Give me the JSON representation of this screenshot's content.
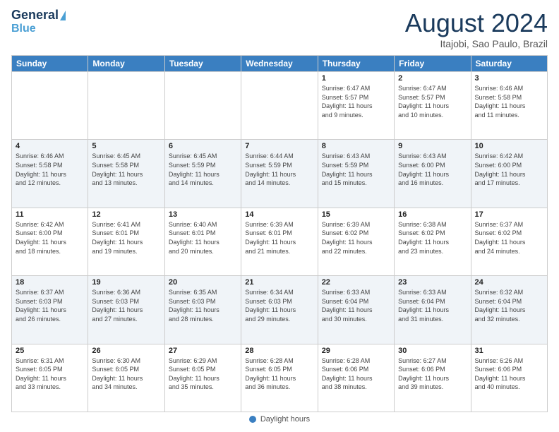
{
  "header": {
    "logo_line1": "General",
    "logo_line2": "Blue",
    "month_title": "August 2024",
    "subtitle": "Itajobi, Sao Paulo, Brazil"
  },
  "days_of_week": [
    "Sunday",
    "Monday",
    "Tuesday",
    "Wednesday",
    "Thursday",
    "Friday",
    "Saturday"
  ],
  "footer_label": "Daylight hours",
  "weeks": [
    [
      {
        "day": "",
        "info": ""
      },
      {
        "day": "",
        "info": ""
      },
      {
        "day": "",
        "info": ""
      },
      {
        "day": "",
        "info": ""
      },
      {
        "day": "1",
        "info": "Sunrise: 6:47 AM\nSunset: 5:57 PM\nDaylight: 11 hours\nand 9 minutes."
      },
      {
        "day": "2",
        "info": "Sunrise: 6:47 AM\nSunset: 5:57 PM\nDaylight: 11 hours\nand 10 minutes."
      },
      {
        "day": "3",
        "info": "Sunrise: 6:46 AM\nSunset: 5:58 PM\nDaylight: 11 hours\nand 11 minutes."
      }
    ],
    [
      {
        "day": "4",
        "info": "Sunrise: 6:46 AM\nSunset: 5:58 PM\nDaylight: 11 hours\nand 12 minutes."
      },
      {
        "day": "5",
        "info": "Sunrise: 6:45 AM\nSunset: 5:58 PM\nDaylight: 11 hours\nand 13 minutes."
      },
      {
        "day": "6",
        "info": "Sunrise: 6:45 AM\nSunset: 5:59 PM\nDaylight: 11 hours\nand 14 minutes."
      },
      {
        "day": "7",
        "info": "Sunrise: 6:44 AM\nSunset: 5:59 PM\nDaylight: 11 hours\nand 14 minutes."
      },
      {
        "day": "8",
        "info": "Sunrise: 6:43 AM\nSunset: 5:59 PM\nDaylight: 11 hours\nand 15 minutes."
      },
      {
        "day": "9",
        "info": "Sunrise: 6:43 AM\nSunset: 6:00 PM\nDaylight: 11 hours\nand 16 minutes."
      },
      {
        "day": "10",
        "info": "Sunrise: 6:42 AM\nSunset: 6:00 PM\nDaylight: 11 hours\nand 17 minutes."
      }
    ],
    [
      {
        "day": "11",
        "info": "Sunrise: 6:42 AM\nSunset: 6:00 PM\nDaylight: 11 hours\nand 18 minutes."
      },
      {
        "day": "12",
        "info": "Sunrise: 6:41 AM\nSunset: 6:01 PM\nDaylight: 11 hours\nand 19 minutes."
      },
      {
        "day": "13",
        "info": "Sunrise: 6:40 AM\nSunset: 6:01 PM\nDaylight: 11 hours\nand 20 minutes."
      },
      {
        "day": "14",
        "info": "Sunrise: 6:39 AM\nSunset: 6:01 PM\nDaylight: 11 hours\nand 21 minutes."
      },
      {
        "day": "15",
        "info": "Sunrise: 6:39 AM\nSunset: 6:02 PM\nDaylight: 11 hours\nand 22 minutes."
      },
      {
        "day": "16",
        "info": "Sunrise: 6:38 AM\nSunset: 6:02 PM\nDaylight: 11 hours\nand 23 minutes."
      },
      {
        "day": "17",
        "info": "Sunrise: 6:37 AM\nSunset: 6:02 PM\nDaylight: 11 hours\nand 24 minutes."
      }
    ],
    [
      {
        "day": "18",
        "info": "Sunrise: 6:37 AM\nSunset: 6:03 PM\nDaylight: 11 hours\nand 26 minutes."
      },
      {
        "day": "19",
        "info": "Sunrise: 6:36 AM\nSunset: 6:03 PM\nDaylight: 11 hours\nand 27 minutes."
      },
      {
        "day": "20",
        "info": "Sunrise: 6:35 AM\nSunset: 6:03 PM\nDaylight: 11 hours\nand 28 minutes."
      },
      {
        "day": "21",
        "info": "Sunrise: 6:34 AM\nSunset: 6:03 PM\nDaylight: 11 hours\nand 29 minutes."
      },
      {
        "day": "22",
        "info": "Sunrise: 6:33 AM\nSunset: 6:04 PM\nDaylight: 11 hours\nand 30 minutes."
      },
      {
        "day": "23",
        "info": "Sunrise: 6:33 AM\nSunset: 6:04 PM\nDaylight: 11 hours\nand 31 minutes."
      },
      {
        "day": "24",
        "info": "Sunrise: 6:32 AM\nSunset: 6:04 PM\nDaylight: 11 hours\nand 32 minutes."
      }
    ],
    [
      {
        "day": "25",
        "info": "Sunrise: 6:31 AM\nSunset: 6:05 PM\nDaylight: 11 hours\nand 33 minutes."
      },
      {
        "day": "26",
        "info": "Sunrise: 6:30 AM\nSunset: 6:05 PM\nDaylight: 11 hours\nand 34 minutes."
      },
      {
        "day": "27",
        "info": "Sunrise: 6:29 AM\nSunset: 6:05 PM\nDaylight: 11 hours\nand 35 minutes."
      },
      {
        "day": "28",
        "info": "Sunrise: 6:28 AM\nSunset: 6:05 PM\nDaylight: 11 hours\nand 36 minutes."
      },
      {
        "day": "29",
        "info": "Sunrise: 6:28 AM\nSunset: 6:06 PM\nDaylight: 11 hours\nand 38 minutes."
      },
      {
        "day": "30",
        "info": "Sunrise: 6:27 AM\nSunset: 6:06 PM\nDaylight: 11 hours\nand 39 minutes."
      },
      {
        "day": "31",
        "info": "Sunrise: 6:26 AM\nSunset: 6:06 PM\nDaylight: 11 hours\nand 40 minutes."
      }
    ]
  ]
}
